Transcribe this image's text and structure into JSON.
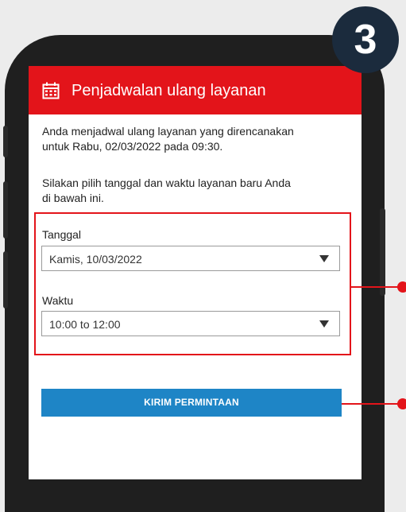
{
  "step": {
    "number": "3"
  },
  "header": {
    "title": "Penjadwalan ulang layanan",
    "icon": "calendar-icon"
  },
  "content": {
    "intro_line1": "Anda menjadwal ulang layanan yang direncanakan",
    "intro_line2": "untuk Rabu, 02/03/2022 pada 09:30.",
    "instruction_line1": "Silakan pilih tanggal dan waktu layanan baru Anda",
    "instruction_line2": "di bawah ini."
  },
  "form": {
    "date_label": "Tanggal",
    "date_value": "Kamis, 10/03/2022",
    "time_label": "Waktu",
    "time_value": "10:00 to 12:00",
    "submit_label": "KIRIM PERMINTAAN"
  },
  "colors": {
    "header_red": "#e3141a",
    "button_blue": "#1e85c6",
    "badge_navy": "#1b2b3d",
    "phone_frame": "#1f1f1f"
  }
}
